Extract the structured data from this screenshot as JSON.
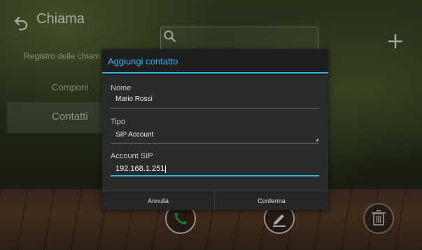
{
  "header": {
    "title": "Chiama"
  },
  "sidebar": {
    "items": [
      {
        "label": "Registro delle chiam"
      },
      {
        "label": "Componi"
      },
      {
        "label": "Contatti"
      }
    ]
  },
  "icons": {
    "back": "back-arrow-icon",
    "search": "search-icon",
    "add": "plus-icon",
    "call": "phone-icon",
    "edit": "pencil-icon",
    "delete": "trash-icon"
  },
  "dialog": {
    "title": "Aggiungi contatto",
    "fields": [
      {
        "label": "Nome",
        "value": "Mario Rossi"
      },
      {
        "label": "Tipo",
        "value": "SIP Account"
      },
      {
        "label": "Account SIP",
        "value": "192.168.1.251"
      }
    ],
    "cancel_label": "Annulla",
    "confirm_label": "Conferma"
  },
  "colors": {
    "accent": "#33b5e5",
    "call_green": "#2fa84f"
  }
}
